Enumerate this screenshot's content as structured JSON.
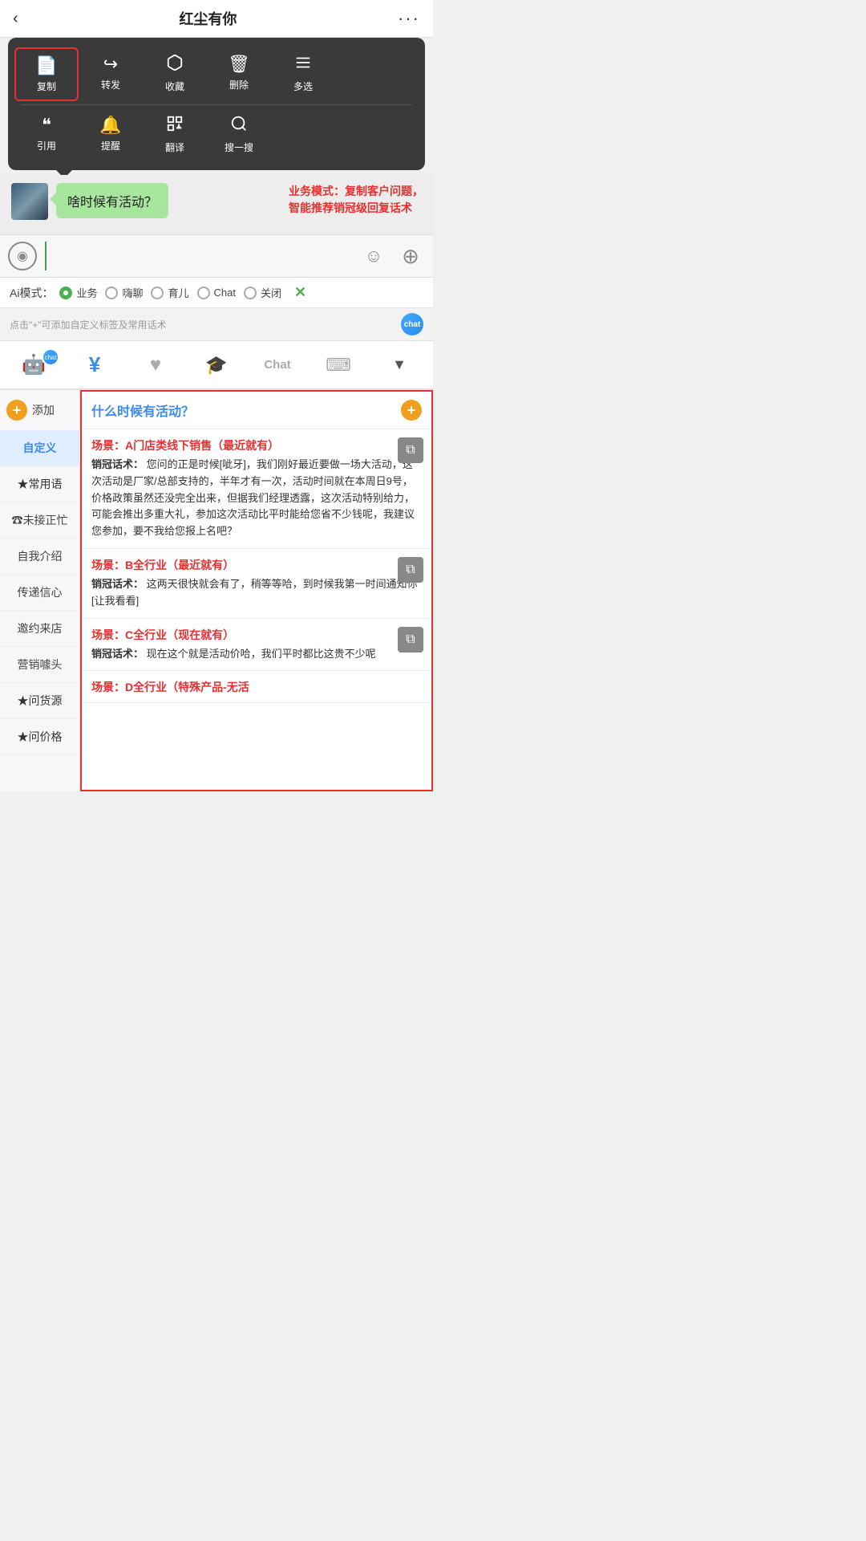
{
  "header": {
    "back_label": "‹",
    "title": "红尘有你",
    "more_label": "···"
  },
  "context_menu": {
    "row1": [
      {
        "icon": "📄",
        "label": "复制",
        "highlighted": true
      },
      {
        "icon": "↪",
        "label": "转发",
        "highlighted": false
      },
      {
        "icon": "⬡",
        "label": "收藏",
        "highlighted": false
      },
      {
        "icon": "🗑",
        "label": "删除",
        "highlighted": false
      },
      {
        "icon": "☰",
        "label": "多选",
        "highlighted": false
      }
    ],
    "row2": [
      {
        "icon": "❝",
        "label": "引用",
        "highlighted": false
      },
      {
        "icon": "🔔",
        "label": "提醒",
        "highlighted": false
      },
      {
        "icon": "⊞",
        "label": "翻译",
        "highlighted": false
      },
      {
        "icon": "✦",
        "label": "搜一搜",
        "highlighted": false
      }
    ]
  },
  "chat": {
    "bubble_text": "啥时候有活动？"
  },
  "annotation": {
    "text": "业务模式：复制客户问题，\n智能推荐销冠级回复话术"
  },
  "input_bar": {
    "placeholder": ""
  },
  "ai_modes": {
    "label": "Ai模式：",
    "options": [
      {
        "label": "业务",
        "active": true
      },
      {
        "label": "嗨聊",
        "active": false
      },
      {
        "label": "育儿",
        "active": false
      },
      {
        "label": "Chat",
        "active": false
      },
      {
        "label": "关闭",
        "active": false
      }
    ],
    "close_label": "✕"
  },
  "hint_bar": {
    "text": "点击\"+\"可添加自定义标签及常用话术"
  },
  "toolbar": {
    "items": [
      {
        "icon": "🤖",
        "label": "chat",
        "active": false,
        "is_robot": true
      },
      {
        "icon": "¥",
        "label": "rmb",
        "active": true
      },
      {
        "icon": "♥",
        "label": "heart",
        "active": false
      },
      {
        "icon": "🎓",
        "label": "hat",
        "active": false
      },
      {
        "icon": "chat",
        "label": "chat_text",
        "active": false,
        "is_text": true
      },
      {
        "icon": "⌨",
        "label": "keyboard",
        "active": false
      },
      {
        "icon": "▼",
        "label": "down",
        "active": false
      }
    ]
  },
  "sidebar": {
    "add_label": "添加",
    "items": [
      {
        "label": "自定义",
        "active": true
      },
      {
        "label": "★常用语",
        "active": false
      },
      {
        "label": "☎未接正忙",
        "active": false
      },
      {
        "label": "自我介绍",
        "active": false
      },
      {
        "label": "传递信心",
        "active": false
      },
      {
        "label": "邀约来店",
        "active": false
      },
      {
        "label": "营销噱头",
        "active": false
      },
      {
        "label": "★问货源",
        "active": false
      },
      {
        "label": "★问价格",
        "active": false
      }
    ]
  },
  "right_panel": {
    "question": "什么时候有活动？",
    "scenarios": [
      {
        "label": "场景：A门店类线下销售（最近就有）",
        "content_bold": "销冠话术：",
        "content": "您问的正是时候[呲牙]，我们刚好最近要做一场大活动，这次活动是厂家/总部支持的，半年才有一次，活动时间就在本周日9号，价格政策虽然还没完全出来，但据我们经理透露，这次活动特别给力，可能会推出多重大礼，参加这次活动比平时能给您省不少钱呢，我建议您参加，要不我给您报上名吧？"
      },
      {
        "label": "场景：B全行业（最近就有）",
        "content_bold": "销冠话术：",
        "content": "这两天很快就会有了，稍等等哈，到时候我第一时间通知你[让我看看]"
      },
      {
        "label": "场景：C全行业（现在就有）",
        "content_bold": "销冠话术：",
        "content": "现在这个就是活动价哈，我们平时都比这贵不少呢"
      },
      {
        "label": "场景：D全行业（特殊产品-无活",
        "content_bold": "",
        "content": ""
      }
    ]
  }
}
